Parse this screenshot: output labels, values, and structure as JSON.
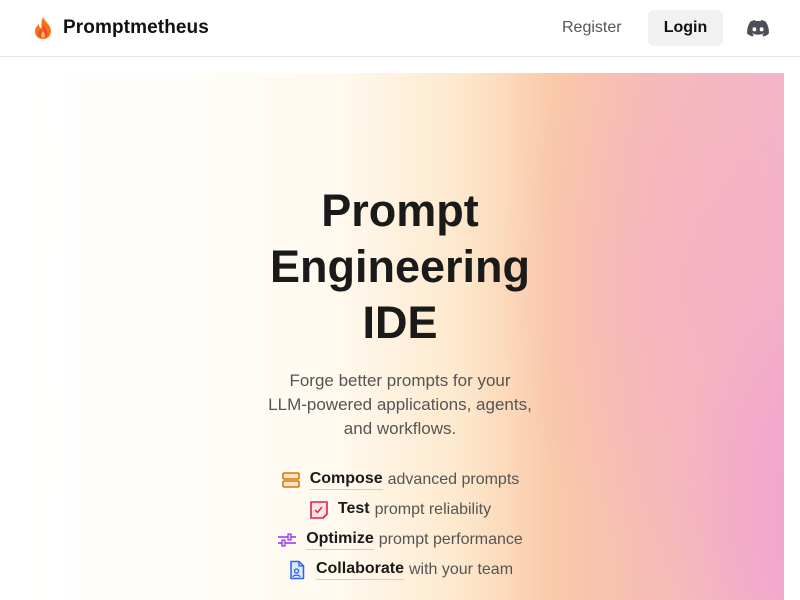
{
  "brand": {
    "name": "Promptmetheus",
    "logo_icon": "flame-icon",
    "colors": [
      "#f97316",
      "#ef4444",
      "#fbbf24"
    ]
  },
  "nav": {
    "register_label": "Register",
    "login_label": "Login",
    "discord_icon": "discord-icon"
  },
  "hero": {
    "title_line1": "Prompt",
    "title_line2": "Engineering",
    "title_line3": "IDE",
    "subtitle_line1": "Forge better prompts for your",
    "subtitle_line2": "LLM-powered applications, agents,",
    "subtitle_line3": "and workflows.",
    "features": [
      {
        "icon": "stack-icon",
        "keyword": "Compose",
        "rest": "advanced prompts",
        "color": "#d97706"
      },
      {
        "icon": "checklist-icon",
        "keyword": "Test",
        "rest": "prompt reliability",
        "color": "#e11d48"
      },
      {
        "icon": "sliders-icon",
        "keyword": "Optimize",
        "rest": "prompt performance",
        "color": "#9333ea"
      },
      {
        "icon": "file-user-icon",
        "keyword": "Collaborate",
        "rest": "with your team",
        "color": "#2563eb"
      }
    ]
  }
}
